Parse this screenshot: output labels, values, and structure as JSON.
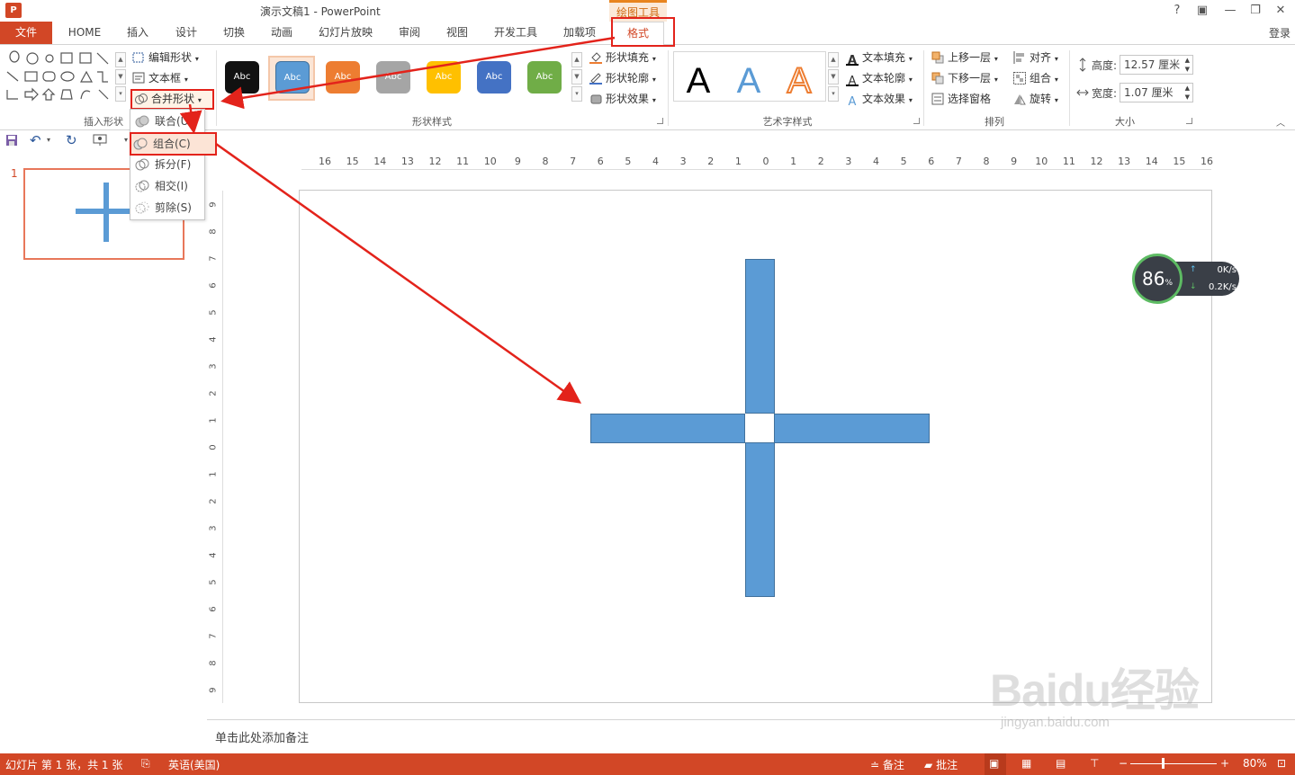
{
  "app": {
    "icon_text": "P",
    "title": "演示文稿1 - PowerPoint",
    "window_controls": [
      "?",
      "⧉",
      "🗕",
      "🗗",
      "✕"
    ]
  },
  "tabs": {
    "file": "文件",
    "items": [
      "HOME",
      "插入",
      "设计",
      "切换",
      "动画",
      "幻灯片放映",
      "审阅",
      "视图",
      "开发工具",
      "加载项"
    ],
    "context_header": "绘图工具",
    "active": "格式",
    "login": "登录"
  },
  "ribbon": {
    "insert_shapes": {
      "label": "插入形状",
      "edit_shape": "编辑形状",
      "text_box": "文本框",
      "merge_shapes": "合并形状"
    },
    "shape_styles": {
      "label": "形状样式",
      "swatch_text": "Abc",
      "swatch_colors": [
        "#111111",
        "#5b9bd5",
        "#ed7d31",
        "#a5a5a5",
        "#ffc000",
        "#4472c4",
        "#70ad47"
      ],
      "fill": "形状填充",
      "outline": "形状轮廓",
      "effects": "形状效果"
    },
    "wordart": {
      "label": "艺术字样式",
      "glyph": "A",
      "text_fill": "文本填充",
      "text_outline": "文本轮廓",
      "text_effects": "文本效果"
    },
    "arrange": {
      "label": "排列",
      "bring_forward": "上移一层",
      "send_backward": "下移一层",
      "selection_pane": "选择窗格",
      "align": "对齐",
      "group": "组合",
      "rotate": "旋转"
    },
    "size": {
      "label": "大小",
      "height_label": "高度:",
      "height_value": "12.57 厘米",
      "width_label": "宽度:",
      "width_value": "1.07 厘米"
    }
  },
  "merge_menu": {
    "items": [
      "联合(U)",
      "组合(C)",
      "拆分(F)",
      "相交(I)",
      "剪除(S)"
    ],
    "highlighted": "组合(C)"
  },
  "slides": {
    "thumbnail_number": "1"
  },
  "ruler": {
    "h_ticks": [
      "16",
      "15",
      "14",
      "13",
      "12",
      "11",
      "10",
      "9",
      "8",
      "7",
      "6",
      "5",
      "4",
      "3",
      "2",
      "1",
      "0",
      "1",
      "2",
      "3",
      "4",
      "5",
      "6",
      "7",
      "8",
      "9",
      "10",
      "11",
      "12",
      "13",
      "14",
      "15",
      "16"
    ],
    "v_ticks": [
      "9",
      "8",
      "7",
      "6",
      "5",
      "4",
      "3",
      "2",
      "1",
      "0",
      "1",
      "2",
      "3",
      "4",
      "5",
      "6",
      "7",
      "8",
      "9"
    ]
  },
  "notes": {
    "placeholder": "单击此处添加备注"
  },
  "status": {
    "slide_info": "幻灯片 第 1 张，共 1 张",
    "language": "英语(美国)",
    "notes_btn": "备注",
    "comments_btn": "批注",
    "zoom": "80%"
  },
  "speed_widget": {
    "percent": "86",
    "percent_unit": "%",
    "upload": "0K/s",
    "download": "0.2K/s"
  },
  "watermark": {
    "brand": "Baidu经验",
    "url": "jingyan.baidu.com"
  }
}
